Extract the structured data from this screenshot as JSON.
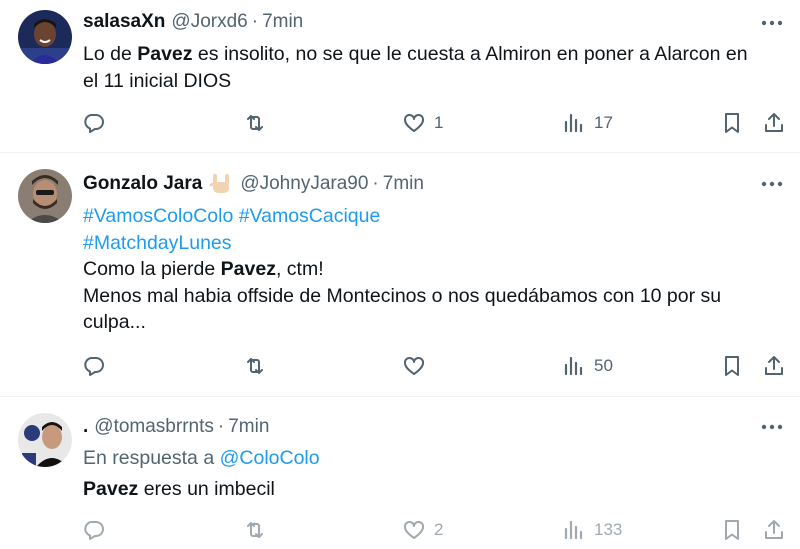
{
  "tweets": [
    {
      "name": "salasaXn",
      "handle": "@Jorxd6",
      "separator": "·",
      "time": "7min",
      "text": {
        "l1_a": "Lo de ",
        "l1_b": "Pavez",
        "l1_c": " es insolito, no se que le cuesta a Almiron en poner a Alarcon en",
        "l2": "el 11 inicial DIOS"
      },
      "likes": "1",
      "views": "17"
    },
    {
      "name": "Gonzalo Jara",
      "emoji": "sign-of-horns-emoji",
      "handle": "@JohnyJara90",
      "separator": "·",
      "time": "7min",
      "text": {
        "hashtags1": "#VamosColoColo #VamosCacique",
        "hashtags2": "#MatchdayLunes",
        "l3_a": "Como la pierde ",
        "l3_b": "Pavez",
        "l3_c": ", ctm!",
        "l4": "Menos mal habia offside de Montecinos o nos quedábamos con 10 por su",
        "l5": "culpa..."
      },
      "likes": "",
      "views": "50"
    },
    {
      "name": ".",
      "handle": "@tomasbrrnts",
      "separator": "·",
      "time": "7min",
      "reply_prefix": "En respuesta a ",
      "reply_to": "@ColoColo",
      "text": {
        "l1_a": "Pavez",
        "l1_b": " eres un imbecil"
      },
      "likes": "2",
      "views": "133"
    }
  ],
  "icons": [
    "more-icon",
    "reply-icon",
    "retweet-icon",
    "like-icon",
    "views-icon",
    "bookmark-icon",
    "share-icon"
  ],
  "colors": {
    "text": "#0f1419",
    "muted": "#536471",
    "link": "#1d9bf0",
    "divider": "#eff3f4"
  }
}
